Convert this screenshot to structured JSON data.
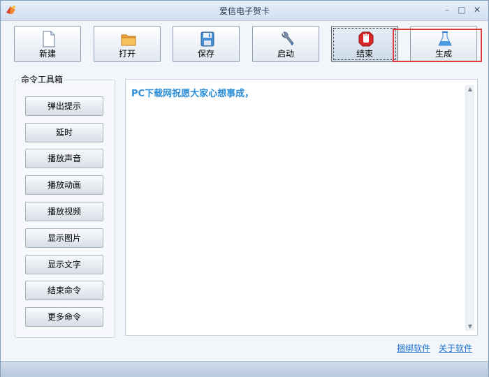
{
  "window": {
    "title": "爱信电子贺卡"
  },
  "titlebar": {
    "minimize_glyph": "–",
    "maximize_glyph": "□",
    "close_glyph": "✕"
  },
  "toolbar": {
    "buttons": [
      {
        "label": "新建",
        "icon": "new-file-icon"
      },
      {
        "label": "打开",
        "icon": "folder-icon"
      },
      {
        "label": "保存",
        "icon": "floppy-disk-icon"
      },
      {
        "label": "启动",
        "icon": "wrench-icon"
      },
      {
        "label": "结束",
        "icon": "stop-hand-icon"
      },
      {
        "label": "生成",
        "icon": "flask-icon"
      }
    ]
  },
  "toolbox": {
    "title": "命令工具箱",
    "commands": [
      "弹出提示",
      "延时",
      "播放声音",
      "播放动画",
      "播放视频",
      "显示图片",
      "显示文字",
      "结束命令",
      "更多命令"
    ]
  },
  "editor": {
    "content": "PC下载网祝愿大家心想事成，"
  },
  "links": {
    "left": "捆绑软件",
    "right": "关于软件"
  },
  "colors": {
    "accent_text": "#2d8fd8",
    "highlight": "#e23a3a",
    "link": "#1a6fd0"
  }
}
